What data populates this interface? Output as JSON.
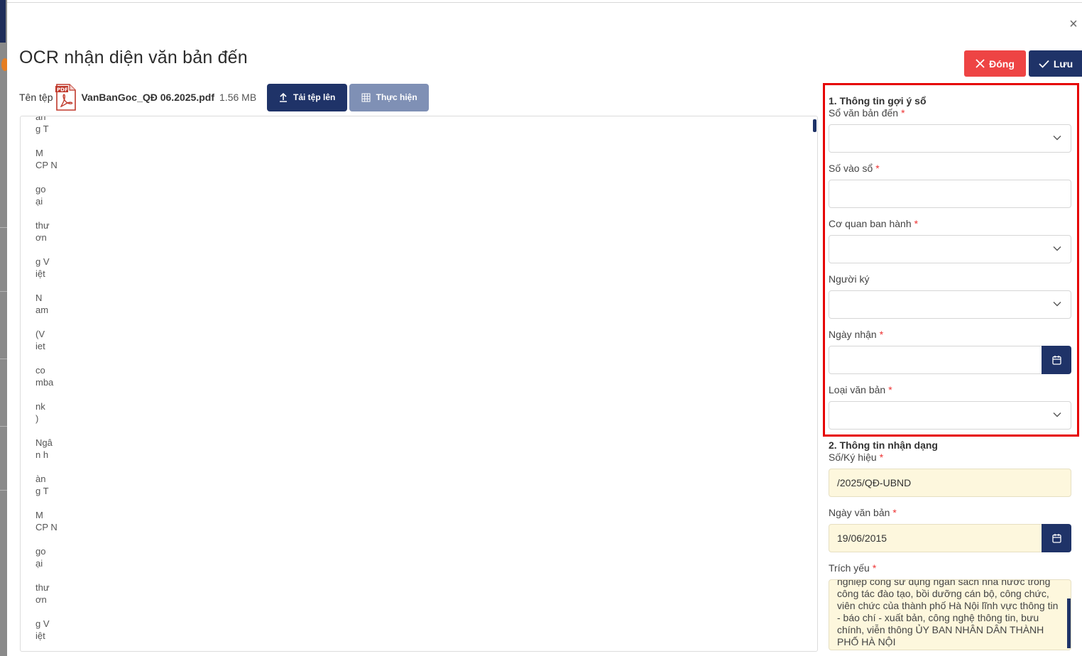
{
  "modal": {
    "title": "OCR nhận diện văn bản đến",
    "close_glyph": "×"
  },
  "actions": {
    "close_label": "Đóng",
    "save_label": "Lưu"
  },
  "file": {
    "label": "Tên tệp",
    "name": "VanBanGoc_QĐ 06.2025.pdf",
    "size": "1.56 MB",
    "upload_label": "Tải tệp lên",
    "execute_label": "Thực hiện"
  },
  "ocr_text": [
    [
      "àn",
      "g T"
    ],
    [
      "M",
      "CP N"
    ],
    [
      "go",
      "ại"
    ],
    [
      "thư",
      "ơn"
    ],
    [
      "g V",
      "iệt"
    ],
    [
      "N",
      "am"
    ],
    [
      "(V",
      "iet"
    ],
    [
      "co",
      "mba"
    ],
    [
      "nk",
      ")"
    ],
    [
      "Ngâ",
      "n h"
    ],
    [
      "àn",
      "g T"
    ],
    [
      "M",
      "CP N"
    ],
    [
      "go",
      "ại"
    ],
    [
      "thư",
      "ơn"
    ],
    [
      "g V",
      "iệt"
    ]
  ],
  "form": {
    "section1_title": "1. Thông tin gợi ý sổ",
    "so_van_ban_den_label": "Sổ văn bản đến",
    "so_vao_so_label": "Số vào sổ",
    "co_quan_label": "Cơ quan ban hành",
    "nguoi_ky_label": "Người ký",
    "ngay_nhan_label": "Ngày nhận",
    "loai_van_ban_label": "Loại văn bản",
    "section2_title": "2. Thông tin nhận dạng",
    "so_ky_hieu_label": "Số/Ký hiệu",
    "so_ky_hieu_value": "/2025/QĐ-UBND",
    "ngay_van_ban_label": "Ngày văn bản",
    "ngay_van_ban_value": "19/06/2015",
    "trich_yeu_label": "Trích yếu",
    "trich_yeu_value": "nghiệp công sử dụng ngân sách nhà nước trong công tác đào tạo, bồi dưỡng cán bộ, công chức, viên chức của thành phố Hà Nội lĩnh vực thông tin - báo chí - xuất bản, công nghệ thông tin, bưu chính, viễn thông ỦY BAN NHÂN DÂN THÀNH PHỐ HÀ NỘI",
    "required_mark": "*"
  },
  "colors": {
    "primary": "#1f3368",
    "danger": "#ee4444",
    "highlight_border": "#e60000",
    "field_highlight": "#fdf7dd"
  }
}
